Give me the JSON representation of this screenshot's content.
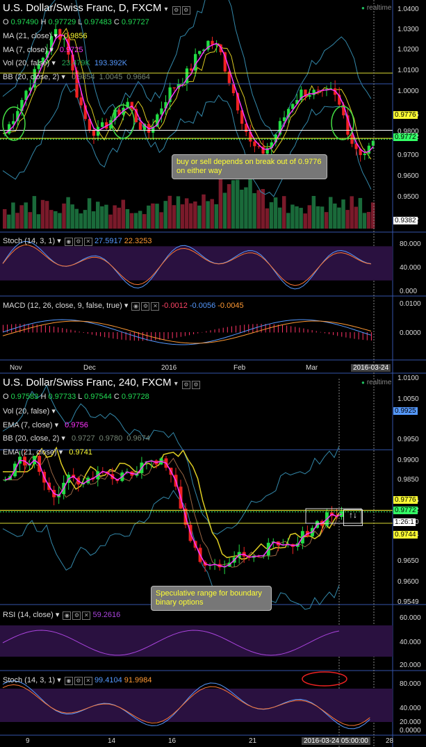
{
  "chart1": {
    "title": "U.S. Dollar/Swiss Franc, D, FXCM",
    "realtime": "realtime",
    "ohlc": {
      "o": "0.97490",
      "h": "0.97729",
      "l": "0.97483",
      "c": "0.97727"
    },
    "indicators": [
      {
        "name": "MA (21, close)",
        "vals": [
          "0.9856"
        ],
        "colors": [
          "#ffff33"
        ]
      },
      {
        "name": "MA (7, close)",
        "vals": [
          "0.9725"
        ],
        "colors": [
          "#ff33ff"
        ]
      },
      {
        "name": "Vol (20, false)",
        "vals": [
          "23.479K",
          "193.392K"
        ],
        "colors": [
          "#22aa55",
          "#5599ff"
        ]
      },
      {
        "name": "BB (20, close, 2)",
        "vals": [
          "0.9854",
          "1.0045",
          "0.9664"
        ],
        "colors": [
          "#778877",
          "#778877",
          "#778877"
        ]
      }
    ],
    "yaxis": [
      "1.0400",
      "1.0300",
      "1.0200",
      "1.0100",
      "1.0000",
      "0.9776",
      "0.9800",
      "0.9772",
      "0.9700",
      "0.9600",
      "0.9500",
      "0.9382"
    ],
    "tags": [
      {
        "text": "0.9776",
        "color": "#ffff33"
      },
      {
        "text": "0.9772",
        "color": "#33ff66"
      },
      {
        "text": "0.9382",
        "color": "#ffffff"
      }
    ],
    "callout": "buy or sell depends on break out of 0.9776 on either way",
    "stoch": {
      "name": "Stoch (14, 3, 1)",
      "k": "27.5917",
      "d": "22.3253",
      "axis": [
        "80.000",
        "40.000",
        "0.000"
      ]
    },
    "macd": {
      "name": "MACD (12, 26, close, 9, false, true)",
      "vals": [
        "-0.0012",
        "-0.0056",
        "-0.0045"
      ],
      "axis": [
        "0.0100",
        "0.0000"
      ]
    },
    "xaxis": [
      "Nov",
      "Dec",
      "2016",
      "Feb",
      "Mar"
    ],
    "xdate": "2016-03-24"
  },
  "chart2": {
    "title": "U.S. Dollar/Swiss Franc, 240, FXCM",
    "realtime": "realtime",
    "ohlc": {
      "o": "0.97583",
      "h": "0.97733",
      "l": "0.97544",
      "c": "0.97728"
    },
    "indicators": [
      {
        "name": "Vol (20, false)",
        "vals": [],
        "colors": []
      },
      {
        "name": "EMA (7, close)",
        "vals": [
          "0.9756"
        ],
        "colors": [
          "#ff33ff"
        ]
      },
      {
        "name": "BB (20, close, 2)",
        "vals": [
          "0.9727",
          "0.9780",
          "0.9674"
        ],
        "colors": [
          "#778877",
          "#778877",
          "#778877"
        ]
      },
      {
        "name": "EMA (21, close)",
        "vals": [
          "0.9741"
        ],
        "colors": [
          "#ffff33"
        ]
      }
    ],
    "yaxis": [
      "1.0100",
      "1.0050",
      "0.9950",
      "0.9900",
      "0.9850",
      "0.9776",
      "0.9772",
      "0.9744",
      "0.9700",
      "0.9650",
      "0.9600",
      "0.9549"
    ],
    "tags": [
      {
        "text": "0.9925",
        "color": "#5599ff"
      },
      {
        "text": "0.9776",
        "color": "#ffff33"
      },
      {
        "text": "0.9772",
        "color": "#33ff66"
      },
      {
        "text": "1:26:1",
        "color": "#ffffff"
      },
      {
        "text": "0.9744",
        "color": "#ffff33"
      }
    ],
    "callout": "Speculative range for boundary binary options",
    "rsi": {
      "name": "RSI (14, close)",
      "val": "59.2616",
      "axis": [
        "60.000",
        "40.000",
        "20.000"
      ]
    },
    "stoch": {
      "name": "Stoch (14, 3, 1)",
      "k": "99.4104",
      "d": "91.9984",
      "axis": [
        "80.000",
        "40.000",
        "20.000",
        "0.0000"
      ]
    },
    "xaxis": [
      "9",
      "14",
      "16",
      "21",
      "28"
    ],
    "xdate": "2016-03-24 05:00:00"
  }
}
